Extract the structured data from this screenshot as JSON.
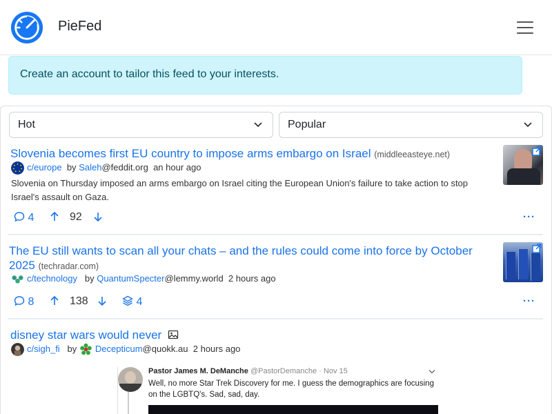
{
  "navbar": {
    "brand": "PieFed",
    "logo_icon": "piefed-logo",
    "menu_icon": "hamburger-icon"
  },
  "alert": {
    "text": "Create an account to tailor this feed to your interests."
  },
  "filters": {
    "sort": "Hot",
    "view": "Popular"
  },
  "posts": [
    {
      "title": "Slovenia becomes first EU country to impose arms embargo on Israel",
      "domain": "(middleeasteye.net)",
      "community": "c/europe",
      "by": "by",
      "user": "Saleh",
      "instance": "@feddit.org",
      "time": "an hour ago",
      "body": "Slovenia on Thursday imposed an arms embargo on Israel citing the European Union's failure to take action to stop Israel's assault on Gaza.",
      "comments": "4",
      "score": "92"
    },
    {
      "title": "The EU still wants to scan all your chats – and the rules could come into force by October 2025",
      "domain": "(techradar.com)",
      "community": "c/technology",
      "by": "by",
      "user": "QuantumSpecter",
      "instance": "@lemmy.world",
      "time": "2 hours ago",
      "comments": "8",
      "score": "138",
      "crossposts": "4"
    },
    {
      "title": "disney star wars would never",
      "community": "c/sigh_fi",
      "by": "by",
      "user": "Decepticum",
      "instance": "@quokk.au",
      "time": "2 hours ago",
      "tweet": {
        "name": "Pastor James M. DeManche",
        "handle": "@PastorDemanche · Nov 15",
        "line1": "Well, no more Star Trek Discovery for me. I guess the demographics are focusing",
        "line2": "on the LGBTQ's. Sad, sad, day."
      }
    }
  ],
  "more_label": "···",
  "colors": {
    "link": "#1a73e8",
    "alert_bg": "#cff4fc",
    "alert_text": "#055160",
    "brand_blue": "#1877f2"
  }
}
